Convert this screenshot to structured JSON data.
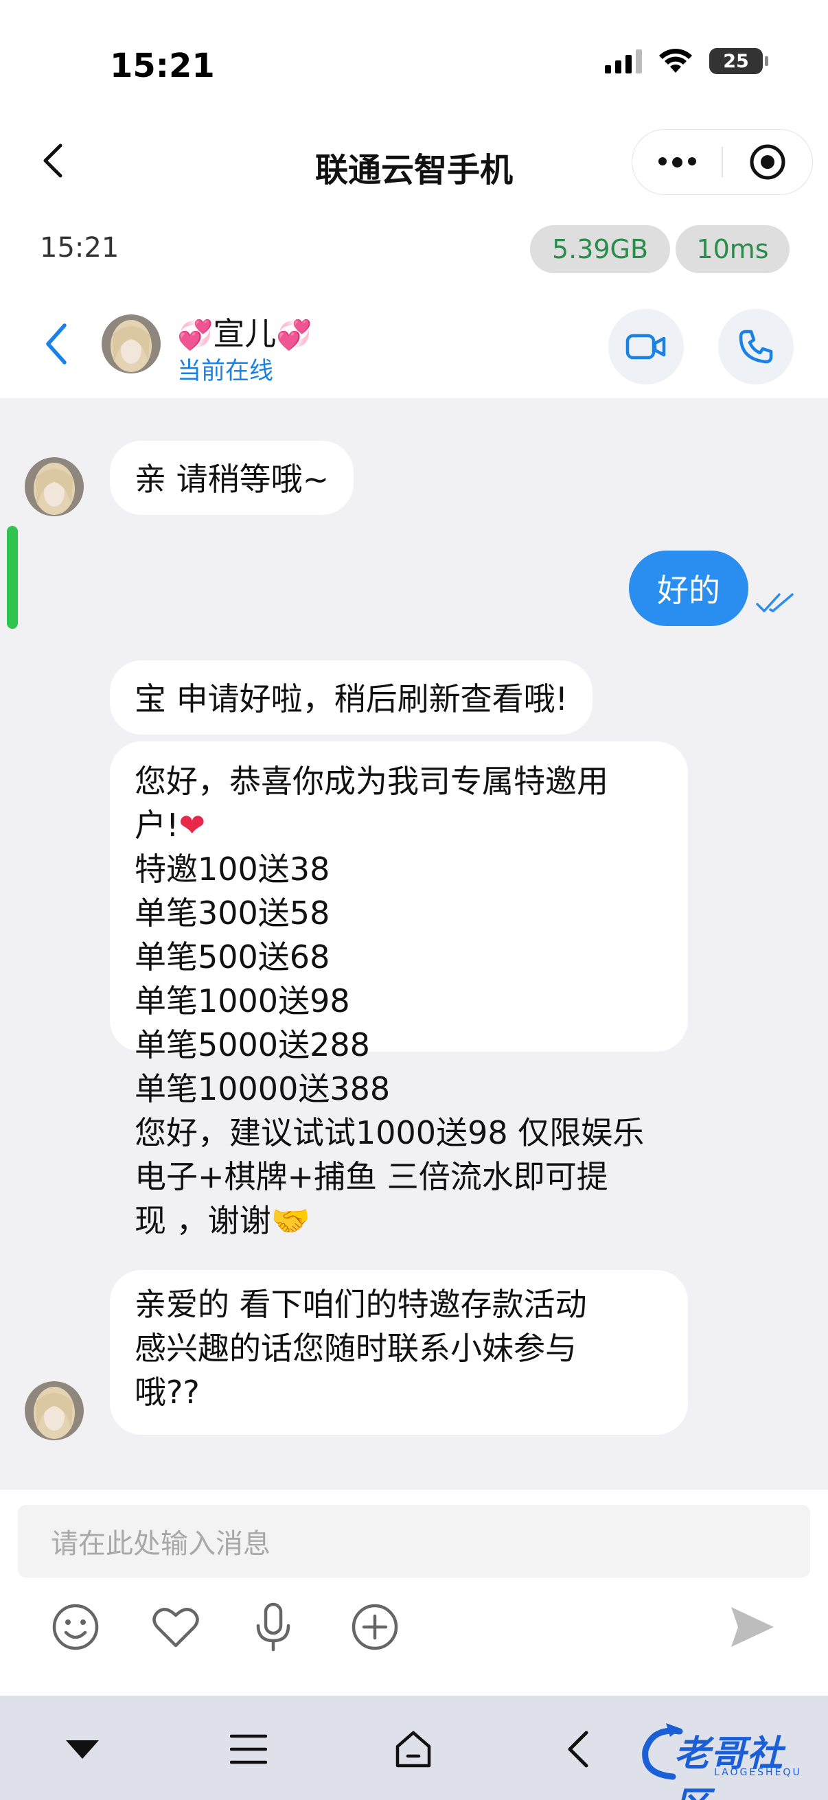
{
  "status_bar": {
    "time": "15:21",
    "battery": "25",
    "icons": [
      "signal-icon",
      "wifi-icon",
      "battery-icon"
    ]
  },
  "mini_program": {
    "title": "联通云智手机",
    "icons": [
      "back-icon",
      "more-icon",
      "record-icon"
    ]
  },
  "cloud_phone": {
    "time": "15:21",
    "memory": "5.39GB",
    "latency": "10ms",
    "accent": "#2a8c4a"
  },
  "chat_header": {
    "name": "宣儿",
    "name_decoration": "💞",
    "status": "当前在线",
    "icons": [
      "back-icon",
      "video-call-icon",
      "phone-call-icon"
    ],
    "accent": "#1a82e6"
  },
  "messages": {
    "m1": "亲  请稍等哦~",
    "m2": "好的",
    "m3": "宝  申请好啦，稍后刷新查看哦!",
    "m4_lines": [
      "您好，恭喜你成为我司专属特邀用",
      "户!",
      "特邀100送38",
      "单笔300送58",
      "单笔500送68",
      "单笔1000送98",
      "单笔5000送288",
      "单笔10000送388",
      "您好，建议试试1000送98  仅限娱乐",
      "电子+棋牌+捕鱼  三倍流水即可提",
      "现 ，谢谢"
    ],
    "m4_emoji_heart": "❤",
    "m4_emoji_hands": "🤝",
    "m5_lines": [
      "亲爱的  看下咱们的特邀存款活动",
      "感兴趣的话您随时联系小妹参与",
      "哦??"
    ],
    "sent_color": "#2a8ef0"
  },
  "input": {
    "placeholder": "请在此处输入消息",
    "icons": [
      "emoji-icon",
      "heart-icon",
      "microphone-icon",
      "plus-icon",
      "send-icon"
    ]
  },
  "nav_bar": {
    "icons": [
      "dropdown-icon",
      "menu-icon",
      "home-icon",
      "back-icon"
    ],
    "watermark": "老哥社区",
    "watermark_sub": "LAOGESHEQU"
  }
}
